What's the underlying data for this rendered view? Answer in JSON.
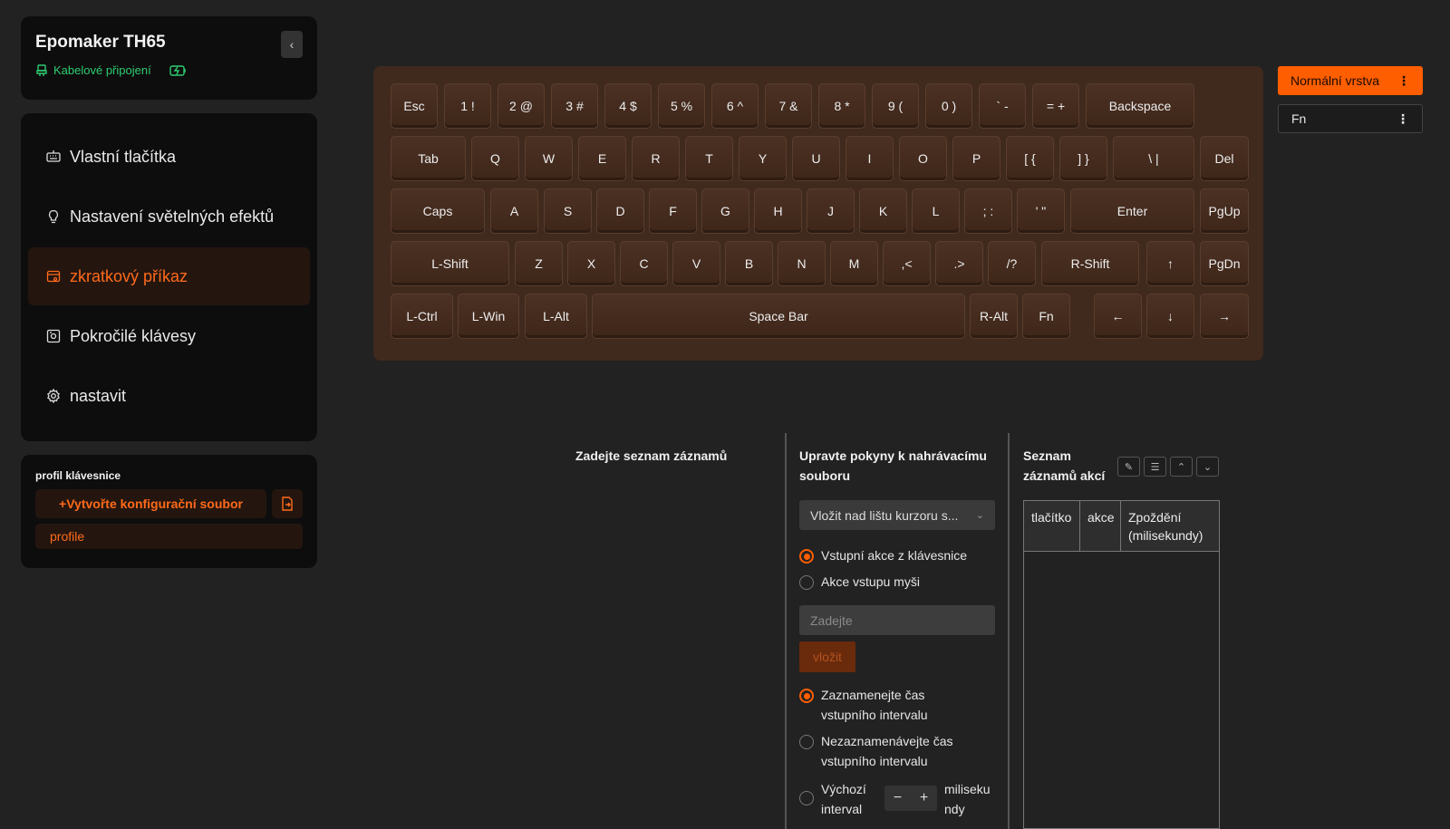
{
  "device": {
    "name": "Epomaker TH65",
    "connection": "Kabelové připojení"
  },
  "colors": {
    "accent": "#ff5e00",
    "connected": "#2ecc71"
  },
  "nav": [
    {
      "label": "Vlastní tlačítka",
      "icon": "keyboard-icon"
    },
    {
      "label": "Nastavení světelných efektů",
      "icon": "lightbulb-icon"
    },
    {
      "label": "zkratkový příkaz",
      "icon": "macro-icon",
      "active": true
    },
    {
      "label": "Pokročilé klávesy",
      "icon": "advanced-key-icon"
    },
    {
      "label": "nastavit",
      "icon": "gear-icon"
    }
  ],
  "profile": {
    "heading": "profil klávesnice",
    "create_label": "+Vytvořte konfigurační soubor",
    "item": "profile"
  },
  "keyboard": {
    "rows": [
      [
        "Esc",
        "1 !",
        "2 @",
        "3 #",
        "4 $",
        "5 %",
        "6 ^",
        "7 &",
        "8 *",
        "9 (",
        "0 )",
        "` -",
        "= +",
        "Backspace"
      ],
      [
        "Tab",
        "Q",
        "W",
        "E",
        "R",
        "T",
        "Y",
        "U",
        "I",
        "O",
        "P",
        "[ {",
        "] }",
        "\\ |",
        "Del"
      ],
      [
        "Caps",
        "A",
        "S",
        "D",
        "F",
        "G",
        "H",
        "J",
        "K",
        "L",
        ";  :",
        "'  \"",
        "Enter",
        "PgUp"
      ],
      [
        "L-Shift",
        "Z",
        "X",
        "C",
        "V",
        "B",
        "N",
        "M",
        ",<",
        ".>",
        "/?",
        "R-Shift",
        "↑",
        "PgDn"
      ],
      [
        "L-Ctrl",
        "L-Win",
        "L-Alt",
        "Space Bar",
        "R-Alt",
        "Fn",
        "←",
        "↓",
        "→"
      ]
    ]
  },
  "layers": {
    "normal": "Normální vrstva",
    "fn": "Fn"
  },
  "macro": {
    "list_title": "Zadejte seznam záznamů",
    "edit_title": "Upravte pokyny k nahrávacímu souboru",
    "insert_position": "Vložit nad lištu kurzoru s...",
    "input_keyboard": "Vstupní akce z klávesnice",
    "input_mouse": "Akce vstupu myši",
    "input_placeholder": "Zadejte",
    "insert_label": "vložit",
    "record_interval": "Zaznamenejte čas vstupního intervalu",
    "no_record_interval": "Nezaznamenávejte čas vstupního intervalu",
    "default_interval": "Výchozí interval",
    "unit": "milisekundy",
    "actions_title": "Seznam záznamů akcí",
    "table_headers": [
      "tlačítko",
      "akce",
      "Zpoždění (milisekundy)"
    ]
  }
}
